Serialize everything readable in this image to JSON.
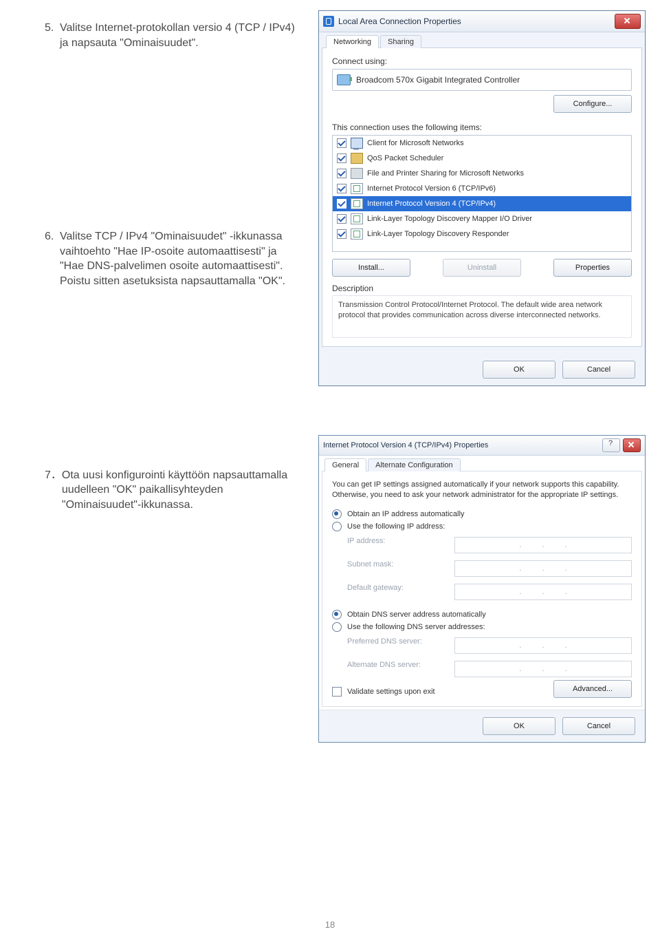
{
  "steps": {
    "s5_num": "5.",
    "s5_text": "Valitse Internet-protokollan versio 4 (TCP / IPv4) ja napsauta \"Ominaisuudet\".",
    "s6_num": "6.",
    "s6_text": "Valitse TCP / IPv4 \"Ominaisuudet\" -ikkunassa vaihtoehto \"Hae IP-osoite automaattisesti\" ja \"Hae DNS-palvelimen osoite automaattisesti\". Poistu sitten asetuksista napsauttamalla \"OK\".",
    "s7_num": "7．",
    "s7_text": "Ota uusi konfigurointi käyttöön napsauttamalla uudelleen \"OK\" paikallisyhteyden \"Ominaisuudet\"-ikkunassa."
  },
  "dlg1": {
    "title": "Local Area Connection Properties",
    "tab_networking": "Networking",
    "tab_sharing": "Sharing",
    "connect_using": "Connect using:",
    "device": "Broadcom 570x Gigabit Integrated Controller",
    "configure": "Configure...",
    "uses_items": "This connection uses the following items:",
    "items": [
      "Client for Microsoft Networks",
      "QoS Packet Scheduler",
      "File and Printer Sharing for Microsoft Networks",
      "Internet Protocol Version 6 (TCP/IPv6)",
      "Internet Protocol Version 4 (TCP/IPv4)",
      "Link-Layer Topology Discovery Mapper I/O Driver",
      "Link-Layer Topology Discovery Responder"
    ],
    "install": "Install...",
    "uninstall": "Uninstall",
    "properties": "Properties",
    "description_lbl": "Description",
    "description_txt": "Transmission Control Protocol/Internet Protocol. The default wide area network protocol that provides communication across diverse interconnected networks.",
    "ok": "OK",
    "cancel": "Cancel"
  },
  "dlg2": {
    "title": "Internet Protocol Version 4 (TCP/IPv4) Properties",
    "tab_general": "General",
    "tab_alt": "Alternate Configuration",
    "intro": "You can get IP settings assigned automatically if your network supports this capability. Otherwise, you need to ask your network administrator for the appropriate IP settings.",
    "r_obtain_ip": "Obtain an IP address automatically",
    "r_use_ip": "Use the following IP address:",
    "ip_address": "IP address:",
    "subnet": "Subnet mask:",
    "gateway": "Default gateway:",
    "r_obtain_dns": "Obtain DNS server address automatically",
    "r_use_dns": "Use the following DNS server addresses:",
    "pref_dns": "Preferred DNS server:",
    "alt_dns": "Alternate DNS server:",
    "validate": "Validate settings upon exit",
    "advanced": "Advanced...",
    "ok": "OK",
    "cancel": "Cancel"
  },
  "page_number": "18"
}
